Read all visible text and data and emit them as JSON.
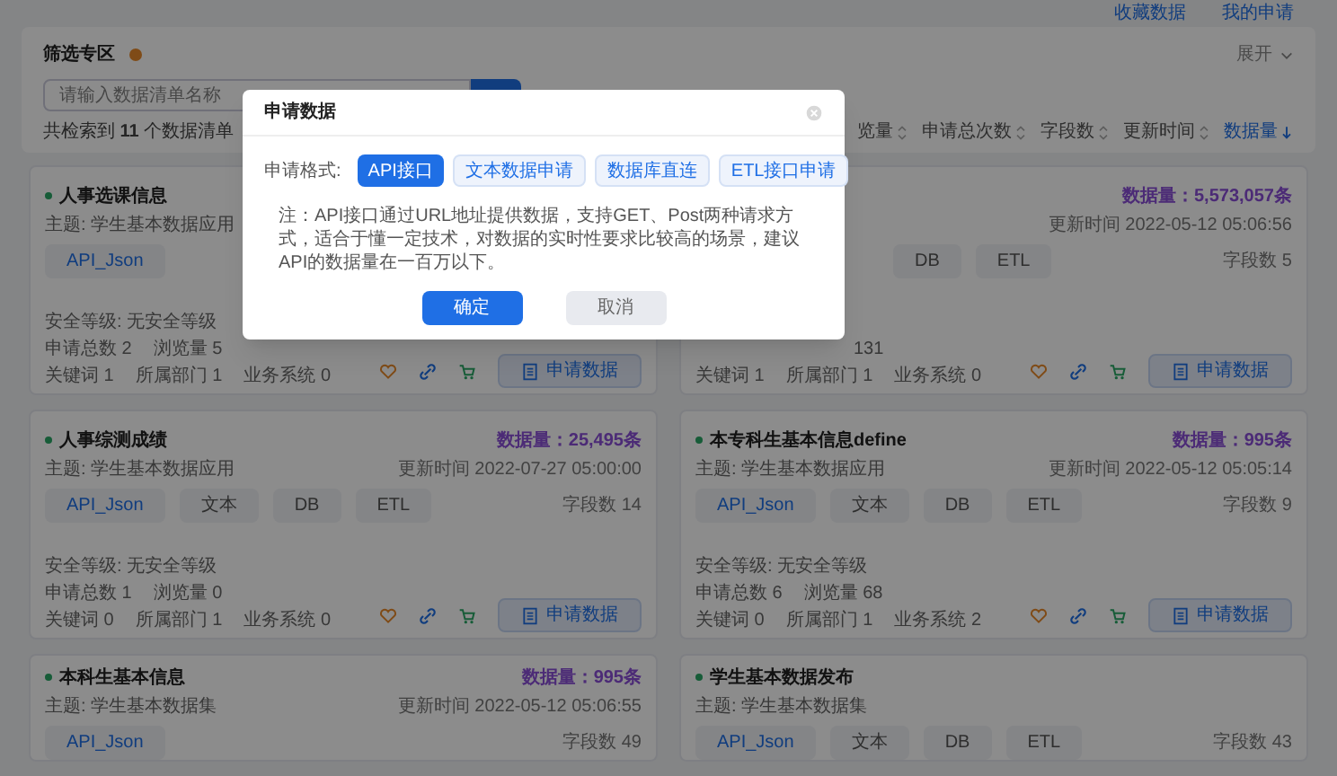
{
  "top_links": [
    "收藏数据",
    "我的申请"
  ],
  "filter": {
    "title": "筛选专区",
    "expand": "展开",
    "search": {
      "placeholder": "请输入数据清单名称"
    }
  },
  "results": {
    "summary": "共检索到 **11** 个数据清单"
  },
  "sort": [
    {
      "label": "览量",
      "selected": false
    },
    {
      "label": "申请总次数",
      "selected": false
    },
    {
      "label": "字段数",
      "selected": false
    },
    {
      "label": "更新时间",
      "selected": false
    },
    {
      "label": "数据量",
      "selected": true
    }
  ],
  "cards": [
    {
      "title": "人事选课信息",
      "topic_label": "主题:",
      "topic": "学生基本数据应用",
      "tags": [
        "API_Json"
      ],
      "security": {
        "label": "安全等级:",
        "value": "无安全等级"
      },
      "stats": [
        [
          {
            "label": "申请总数",
            "value": "2"
          },
          {
            "label": "浏览量",
            "value": "5"
          }
        ],
        [
          {
            "label": "关键词",
            "value": "1"
          },
          {
            "label": "所属部门",
            "value": "1"
          },
          {
            "label": "业务系统",
            "value": "0"
          }
        ]
      ],
      "apply_button": "申请数据"
    },
    {
      "volume": "数据量：5,573,057条",
      "updated_label": "更新时间",
      "updated": "2022-05-12 05:06:56",
      "tags": [
        "DB",
        "ETL"
      ],
      "field_label": "字段数",
      "field_count": "5",
      "stats": [
        [
          {
            "value": "131"
          }
        ],
        [
          {
            "label": "关键词",
            "value": "1"
          },
          {
            "label": "所属部门",
            "value": "1"
          },
          {
            "label": "业务系统",
            "value": "0"
          }
        ]
      ],
      "apply_button": "申请数据"
    },
    {
      "title": "人事综测成绩",
      "volume": "数据量：25,495条",
      "topic_label": "主题:",
      "topic": "学生基本数据应用",
      "updated_label": "更新时间",
      "updated": "2022-07-27 05:00:00",
      "tags": [
        "API_Json",
        "文本",
        "DB",
        "ETL"
      ],
      "field_label": "字段数",
      "field_count": "14",
      "security": {
        "label": "安全等级:",
        "value": "无安全等级"
      },
      "stats": [
        [
          {
            "label": "申请总数",
            "value": "1"
          },
          {
            "label": "浏览量",
            "value": "0"
          }
        ],
        [
          {
            "label": "关键词",
            "value": "0"
          },
          {
            "label": "所属部门",
            "value": "1"
          },
          {
            "label": "业务系统",
            "value": "0"
          }
        ]
      ],
      "apply_button": "申请数据"
    },
    {
      "title": "本专科生基本信息define",
      "volume": "数据量：995条",
      "topic_label": "主题:",
      "topic": "学生基本数据应用",
      "updated_label": "更新时间",
      "updated": "2022-05-12 05:05:14",
      "tags": [
        "API_Json",
        "文本",
        "DB",
        "ETL"
      ],
      "field_label": "字段数",
      "field_count": "9",
      "security": {
        "label": "安全等级:",
        "value": "无安全等级"
      },
      "stats": [
        [
          {
            "label": "申请总数",
            "value": "6"
          },
          {
            "label": "浏览量",
            "value": "68"
          }
        ],
        [
          {
            "label": "关键词",
            "value": "0"
          },
          {
            "label": "所属部门",
            "value": "1"
          },
          {
            "label": "业务系统",
            "value": "2"
          }
        ]
      ],
      "apply_button": "申请数据"
    },
    {
      "title": "本科生基本信息",
      "volume": "数据量：995条",
      "topic_label": "主题:",
      "topic": "学生基本数据集",
      "updated_label": "更新时间",
      "updated": "2022-05-12 05:06:55",
      "tags": [
        "API_Json"
      ],
      "field_label": "字段数",
      "field_count": "49"
    },
    {
      "title": "学生基本数据发布",
      "topic_label": "主题:",
      "topic": "学生基本数据集",
      "tags": [
        "API_Json",
        "文本",
        "DB",
        "ETL"
      ],
      "field_label": "字段数",
      "field_count": "43"
    }
  ],
  "dialog": {
    "title": "申请数据",
    "format_label": "申请格式:",
    "options": [
      {
        "label": "API接口",
        "selected": true
      },
      {
        "label": "文本数据申请",
        "selected": false
      },
      {
        "label": "数据库直连",
        "selected": false
      },
      {
        "label": "ETL接口申请",
        "selected": false
      }
    ],
    "note": "注：API接口通过URL地址提供数据，支持GET、Post两种请求方式，适合于懂一定技术，对数据的实时性要求比较高的场景，建议API的数据量在一百万以下。",
    "confirm": "确定",
    "cancel": "取消"
  }
}
